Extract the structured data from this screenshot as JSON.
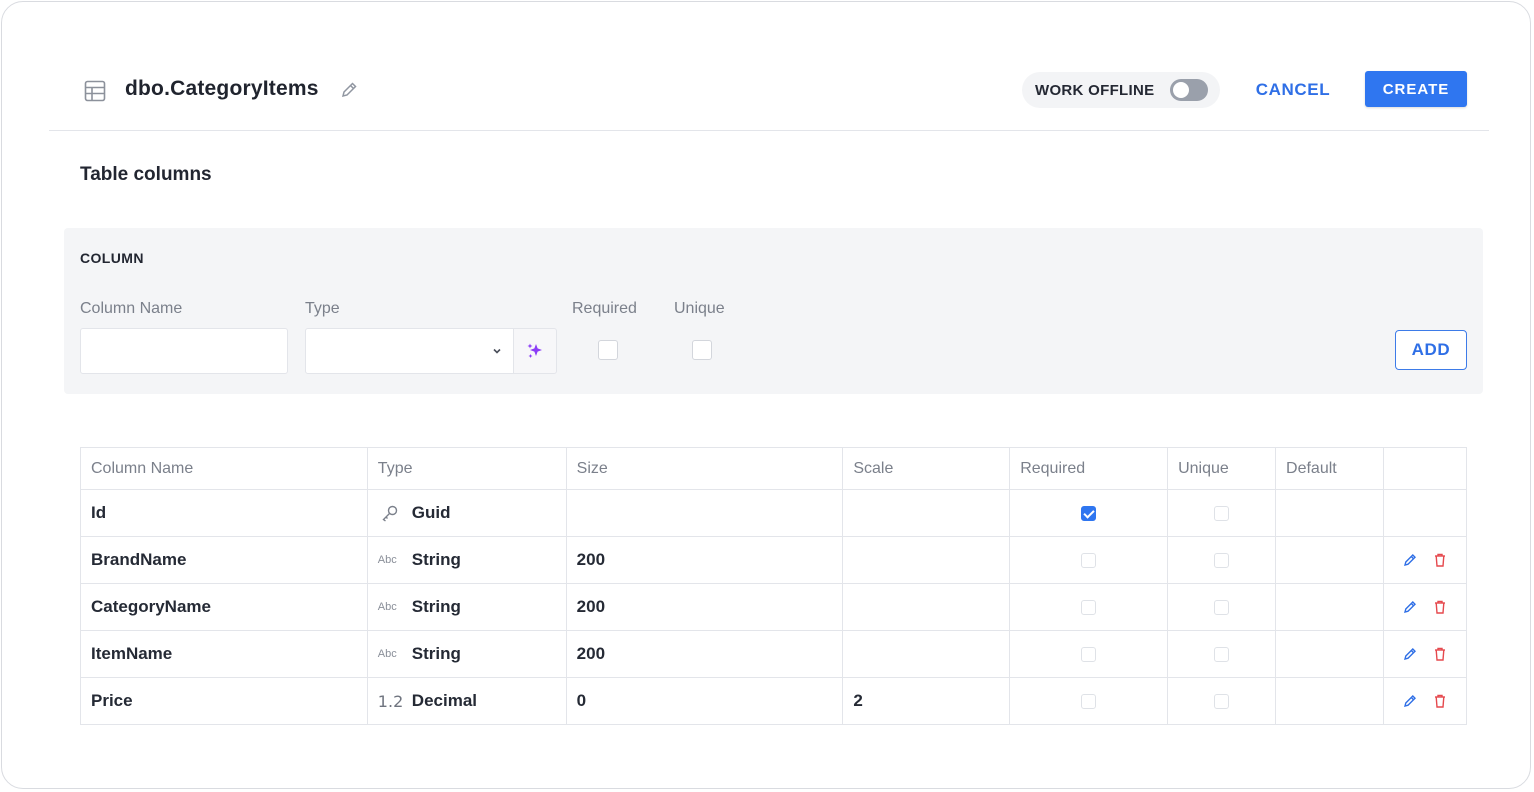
{
  "header": {
    "title": "dbo.CategoryItems",
    "work_offline_label": "WORK OFFLINE",
    "work_offline_enabled": false,
    "cancel_label": "CANCEL",
    "create_label": "CREATE"
  },
  "section_title": "Table columns",
  "column_form": {
    "heading": "COLUMN",
    "column_name_label": "Column Name",
    "column_name_value": "",
    "type_label": "Type",
    "type_value": "",
    "required_label": "Required",
    "required_checked": false,
    "unique_label": "Unique",
    "unique_checked": false,
    "add_label": "ADD"
  },
  "table": {
    "headers": [
      "Column Name",
      "Type",
      "Size",
      "Scale",
      "Required",
      "Unique",
      "Default",
      ""
    ],
    "rows": [
      {
        "name": "Id",
        "type_icon": "key-icon",
        "type": "Guid",
        "size": "",
        "scale": "",
        "required": true,
        "unique": false,
        "default": "",
        "editable": false
      },
      {
        "name": "BrandName",
        "type_icon": "string-icon",
        "type": "String",
        "size": "200",
        "scale": "",
        "required": false,
        "unique": false,
        "default": "",
        "editable": true
      },
      {
        "name": "CategoryName",
        "type_icon": "string-icon",
        "type": "String",
        "size": "200",
        "scale": "",
        "required": false,
        "unique": false,
        "default": "",
        "editable": true
      },
      {
        "name": "ItemName",
        "type_icon": "string-icon",
        "type": "String",
        "size": "200",
        "scale": "",
        "required": false,
        "unique": false,
        "default": "",
        "editable": true
      },
      {
        "name": "Price",
        "type_icon": "decimal-icon",
        "type": "Decimal",
        "size": "0",
        "scale": "2",
        "required": false,
        "unique": false,
        "default": "",
        "editable": true
      }
    ],
    "icon_glyphs": {
      "string-icon": "Abc",
      "decimal-icon": "1.2"
    }
  },
  "colors": {
    "accent": "#2f76f0",
    "danger": "#e5484d",
    "ai": "#8b3cf6"
  }
}
